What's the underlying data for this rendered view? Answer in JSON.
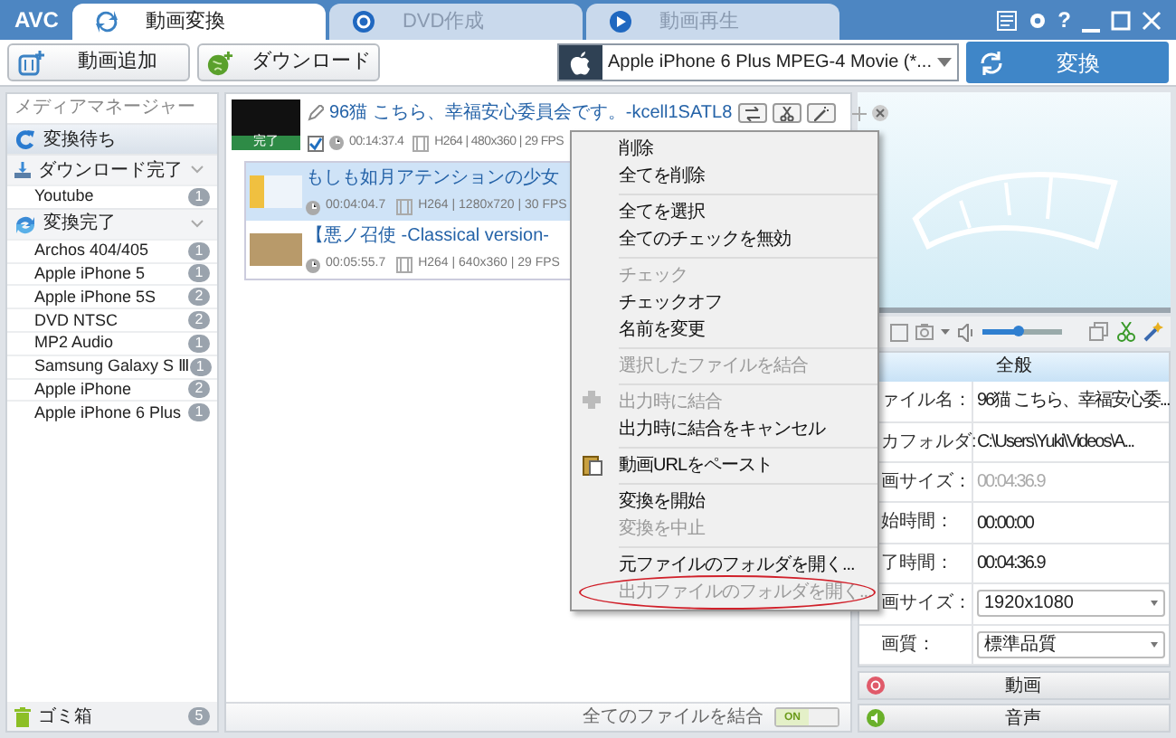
{
  "window": {
    "logo": "AVC",
    "controls": [
      "?"
    ]
  },
  "tabs": [
    {
      "label": "動画変換",
      "selected": true
    },
    {
      "label": "DVD作成",
      "selected": false
    },
    {
      "label": "動画再生",
      "selected": false
    }
  ],
  "toolbar": {
    "add_button": "動画追加",
    "download_button": "ダウンロード",
    "profile": "Apple iPhone 6 Plus MPEG-4 Movie (*...",
    "convert_button": "変換"
  },
  "sidebar": {
    "title": "メディアマネージャー",
    "sections": [
      {
        "label": "変換待ち",
        "selected": true
      },
      {
        "label": "ダウンロード完了",
        "selected": false,
        "expanded": true,
        "children": [
          {
            "label": "Youtube",
            "count": "1"
          }
        ]
      },
      {
        "label": "変換完了",
        "selected": false,
        "expanded": true,
        "children": [
          {
            "label": "Archos 404/405",
            "count": "1"
          },
          {
            "label": "Apple iPhone 5",
            "count": "1"
          },
          {
            "label": "Apple iPhone 5S",
            "count": "2"
          },
          {
            "label": "DVD NTSC",
            "count": "2"
          },
          {
            "label": "MP2 Audio",
            "count": "1"
          },
          {
            "label": "Samsung Galaxy S Ⅲ",
            "count": "1"
          },
          {
            "label": "Apple iPhone",
            "count": "2"
          },
          {
            "label": "Apple iPhone 6 Plus",
            "count": "1"
          }
        ]
      }
    ],
    "trash": {
      "label": "ゴミ箱",
      "count": "5"
    }
  },
  "files": [
    {
      "title": "96猫 こちら、幸福安心委員会です。-kcell1SATL8",
      "status": "完了",
      "checked": true,
      "duration": "00:14:37.4",
      "codec": "H264 | 480x360 | 29 FPS",
      "children": [
        {
          "title": "もしも如月アテンションの少女",
          "duration": "00:04:04.7",
          "codec": "H264 | 1280x720 | 30 FPS",
          "selected": true
        },
        {
          "title": "【悪ノ召使 -Classical version-",
          "duration": "00:05:55.7",
          "codec": "H264 | 640x360 | 29 FPS",
          "selected": false
        }
      ]
    }
  ],
  "merge_all": {
    "label": "全てのファイルを結合",
    "toggle": "ON",
    "on": true
  },
  "context_menu": [
    {
      "kind": "item",
      "label": "削除",
      "disabled": false
    },
    {
      "kind": "item",
      "label": "全てを削除",
      "disabled": false
    },
    {
      "kind": "separator"
    },
    {
      "kind": "item",
      "label": "全てを選択",
      "disabled": false
    },
    {
      "kind": "item",
      "label": "全てのチェックを無効",
      "disabled": false
    },
    {
      "kind": "separator"
    },
    {
      "kind": "item",
      "label": "チェック",
      "disabled": true
    },
    {
      "kind": "item",
      "label": "チェックオフ",
      "disabled": false
    },
    {
      "kind": "item",
      "label": "名前を変更",
      "disabled": false
    },
    {
      "kind": "separator"
    },
    {
      "kind": "item",
      "label": "選択したファイルを結合",
      "disabled": true
    },
    {
      "kind": "separator"
    },
    {
      "kind": "icon_item",
      "label": "出力時に結合",
      "disabled": true
    },
    {
      "kind": "item",
      "label": "出力時に結合をキャンセル",
      "disabled": false
    },
    {
      "kind": "separator"
    },
    {
      "kind": "icon_item",
      "label": "動画URLをペースト",
      "disabled": false
    },
    {
      "kind": "separator"
    },
    {
      "kind": "item",
      "label": "変換を開始",
      "disabled": false
    },
    {
      "kind": "item",
      "label": "変換を中止",
      "disabled": true
    },
    {
      "kind": "separator"
    },
    {
      "kind": "item",
      "label": "元ファイルのフォルダを開く...",
      "disabled": false
    },
    {
      "kind": "item",
      "label": "出力ファイルのフォルダを開く...",
      "disabled": true,
      "circled": true
    }
  ],
  "player": {
    "volume": {
      "level": 0.45
    }
  },
  "properties": {
    "header": "全般",
    "rows": [
      {
        "label": "ァイル名：",
        "value": "96猫 こちら、幸福安心委...",
        "kind": "text"
      },
      {
        "label": "カフォルダ:",
        "value": "C:\\Users\\Yuki\\Videos\\A...",
        "kind": "text"
      },
      {
        "label": "画サイズ：",
        "value": "00:04:36.9",
        "kind": "readonly"
      },
      {
        "label": "始時間：",
        "value": "00:00:00",
        "kind": "text"
      },
      {
        "label": "了時間：",
        "value": "00:04:36.9",
        "kind": "text"
      },
      {
        "label": "画サイズ：",
        "value": "1920x1080",
        "kind": "dropdown"
      },
      {
        "label": "画質：",
        "value": "標準品質",
        "kind": "dropdown"
      }
    ]
  },
  "bottom_tabs": [
    {
      "label": "動画"
    },
    {
      "label": "音声"
    }
  ]
}
